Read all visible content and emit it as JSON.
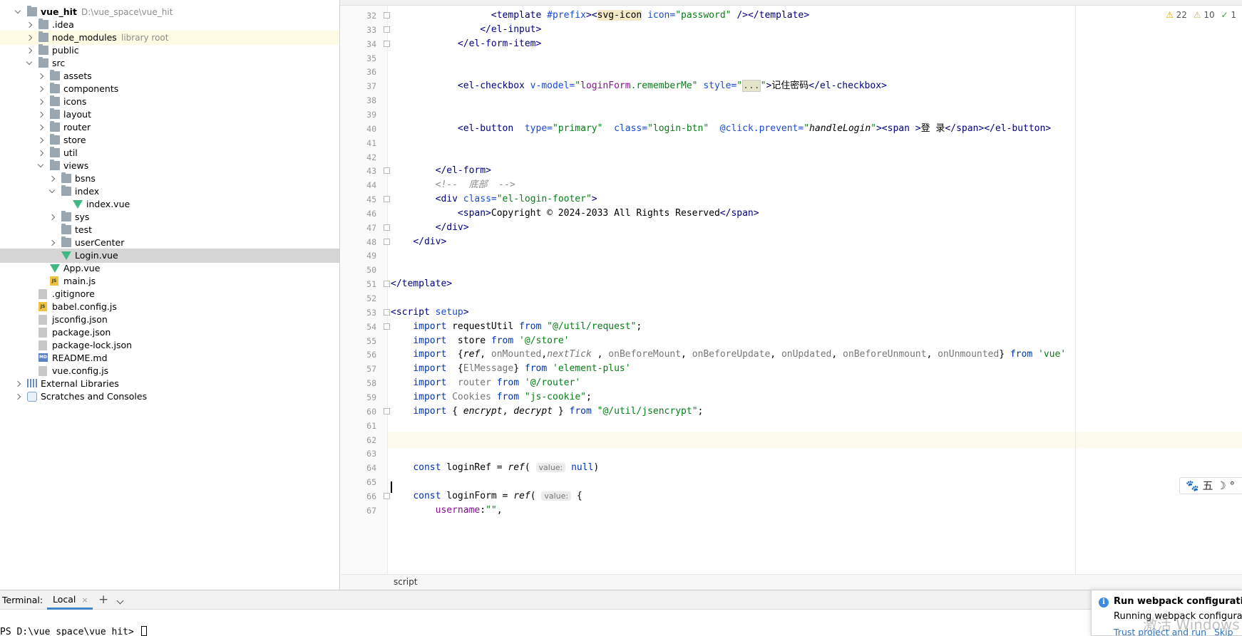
{
  "project_tree": [
    {
      "label": "vue_hit",
      "extra": "D:\\vue_space\\vue_hit",
      "depth": 0,
      "arrow": "down",
      "icon": "folder",
      "bold": true
    },
    {
      "label": ".idea",
      "depth": 1,
      "arrow": "right",
      "icon": "folder"
    },
    {
      "label": "node_modules",
      "extra": "library root",
      "depth": 1,
      "arrow": "right",
      "icon": "folder",
      "highlight": true
    },
    {
      "label": "public",
      "depth": 1,
      "arrow": "right",
      "icon": "folder"
    },
    {
      "label": "src",
      "depth": 1,
      "arrow": "down",
      "icon": "folder"
    },
    {
      "label": "assets",
      "depth": 2,
      "arrow": "right",
      "icon": "folder"
    },
    {
      "label": "components",
      "depth": 2,
      "arrow": "right",
      "icon": "folder"
    },
    {
      "label": "icons",
      "depth": 2,
      "arrow": "right",
      "icon": "folder"
    },
    {
      "label": "layout",
      "depth": 2,
      "arrow": "right",
      "icon": "folder"
    },
    {
      "label": "router",
      "depth": 2,
      "arrow": "right",
      "icon": "folder"
    },
    {
      "label": "store",
      "depth": 2,
      "arrow": "right",
      "icon": "folder"
    },
    {
      "label": "util",
      "depth": 2,
      "arrow": "right",
      "icon": "folder"
    },
    {
      "label": "views",
      "depth": 2,
      "arrow": "down",
      "icon": "folder"
    },
    {
      "label": "bsns",
      "depth": 3,
      "arrow": "right",
      "icon": "folder"
    },
    {
      "label": "index",
      "depth": 3,
      "arrow": "down",
      "icon": "folder"
    },
    {
      "label": "index.vue",
      "depth": 4,
      "arrow": "none",
      "icon": "vue"
    },
    {
      "label": "sys",
      "depth": 3,
      "arrow": "right",
      "icon": "folder"
    },
    {
      "label": "test",
      "depth": 3,
      "arrow": "none",
      "icon": "folder"
    },
    {
      "label": "userCenter",
      "depth": 3,
      "arrow": "right",
      "icon": "folder"
    },
    {
      "label": "Login.vue",
      "depth": 3,
      "arrow": "none",
      "icon": "vue",
      "selected": true
    },
    {
      "label": "App.vue",
      "depth": 2,
      "arrow": "none",
      "icon": "vue"
    },
    {
      "label": "main.js",
      "depth": 2,
      "arrow": "none",
      "icon": "js"
    },
    {
      "label": ".gitignore",
      "depth": 1,
      "arrow": "none",
      "icon": "file"
    },
    {
      "label": "babel.config.js",
      "depth": 1,
      "arrow": "none",
      "icon": "js"
    },
    {
      "label": "jsconfig.json",
      "depth": 1,
      "arrow": "none",
      "icon": "file"
    },
    {
      "label": "package.json",
      "depth": 1,
      "arrow": "none",
      "icon": "file"
    },
    {
      "label": "package-lock.json",
      "depth": 1,
      "arrow": "none",
      "icon": "file"
    },
    {
      "label": "README.md",
      "depth": 1,
      "arrow": "none",
      "icon": "md"
    },
    {
      "label": "vue.config.js",
      "depth": 1,
      "arrow": "none",
      "icon": "file"
    },
    {
      "label": "External Libraries",
      "depth": 0,
      "arrow": "right",
      "icon": "lib"
    },
    {
      "label": "Scratches and Consoles",
      "depth": 0,
      "arrow": "right",
      "icon": "scratch"
    }
  ],
  "inspections": {
    "errors_warn": "22",
    "warnings": "10",
    "ok": "1"
  },
  "code_lines": [
    {
      "n": "32",
      "fold": true,
      "tokens": [
        [
          "",
          "                  "
        ],
        [
          "tag",
          "<template "
        ],
        [
          "attr",
          "#prefix"
        ],
        [
          "tag",
          ">"
        ],
        [
          "tag",
          "<"
        ],
        [
          "hl",
          "svg-icon"
        ],
        [
          "attr",
          " icon="
        ],
        [
          "str",
          "\"password\""
        ],
        [
          "tag",
          " /></template>"
        ]
      ]
    },
    {
      "n": "33",
      "fold": true,
      "tokens": [
        [
          "",
          "                "
        ],
        [
          "tag",
          "</el-input>"
        ]
      ]
    },
    {
      "n": "34",
      "fold": true,
      "tokens": [
        [
          "",
          "            "
        ],
        [
          "tag",
          "</el-form-item>"
        ]
      ]
    },
    {
      "n": "35",
      "tokens": []
    },
    {
      "n": "36",
      "tokens": []
    },
    {
      "n": "37",
      "tokens": [
        [
          "",
          "            "
        ],
        [
          "tag",
          "<el-checkbox "
        ],
        [
          "attr",
          "v-model="
        ],
        [
          "str",
          "\""
        ],
        [
          "var",
          "loginForm"
        ],
        [
          "str",
          ".rememberMe\""
        ],
        [
          "attr",
          " style="
        ],
        [
          "str",
          "\""
        ],
        [
          "fold",
          "..."
        ],
        [
          "str",
          "\""
        ],
        [
          "tag",
          ">"
        ],
        [
          "",
          "记住密码"
        ],
        [
          "tag",
          "</el-checkbox>"
        ]
      ]
    },
    {
      "n": "38",
      "tokens": []
    },
    {
      "n": "39",
      "tokens": []
    },
    {
      "n": "40",
      "tokens": [
        [
          "",
          "            "
        ],
        [
          "tag",
          "<el-button  "
        ],
        [
          "attr",
          "type="
        ],
        [
          "str",
          "\"primary\""
        ],
        [
          "attr",
          "  class="
        ],
        [
          "str",
          "\"login-btn\""
        ],
        [
          "attr",
          "  @click.prevent="
        ],
        [
          "str",
          "\""
        ],
        [
          "fn",
          "handleLogin"
        ],
        [
          "str",
          "\""
        ],
        [
          "tag",
          "><span >"
        ],
        [
          "",
          "登 录"
        ],
        [
          "tag",
          "</span></el-button>"
        ]
      ]
    },
    {
      "n": "41",
      "tokens": []
    },
    {
      "n": "42",
      "tokens": []
    },
    {
      "n": "43",
      "fold": true,
      "tokens": [
        [
          "",
          "        "
        ],
        [
          "tag",
          "</el-form>"
        ]
      ]
    },
    {
      "n": "44",
      "tokens": [
        [
          "",
          "        "
        ],
        [
          "cm",
          "<!--  底部  -->"
        ]
      ]
    },
    {
      "n": "45",
      "fold": true,
      "tokens": [
        [
          "",
          "        "
        ],
        [
          "tag",
          "<div "
        ],
        [
          "attr",
          "class="
        ],
        [
          "str",
          "\"el-login-footer\""
        ],
        [
          "tag",
          ">"
        ]
      ]
    },
    {
      "n": "46",
      "tokens": [
        [
          "",
          "            "
        ],
        [
          "tag",
          "<span>"
        ],
        [
          "",
          "Copyright © 2024-2033 All Rights Reserved"
        ],
        [
          "tag",
          "</span>"
        ]
      ]
    },
    {
      "n": "47",
      "fold": true,
      "tokens": [
        [
          "",
          "        "
        ],
        [
          "tag",
          "</div>"
        ]
      ]
    },
    {
      "n": "48",
      "fold": true,
      "tokens": [
        [
          "",
          "    "
        ],
        [
          "tag",
          "</div>"
        ]
      ]
    },
    {
      "n": "49",
      "tokens": []
    },
    {
      "n": "50",
      "tokens": []
    },
    {
      "n": "51",
      "fold": true,
      "tokens": [
        [
          "tag",
          "</template>"
        ]
      ]
    },
    {
      "n": "52",
      "tokens": []
    },
    {
      "n": "53",
      "fold": true,
      "tokens": [
        [
          "tag",
          "<script "
        ],
        [
          "attr",
          "setup"
        ],
        [
          "tag",
          ">"
        ]
      ]
    },
    {
      "n": "54",
      "fold": true,
      "tokens": [
        [
          "",
          "    "
        ],
        [
          "kw",
          "import "
        ],
        [
          "",
          "requestUtil "
        ],
        [
          "kw",
          "from "
        ],
        [
          "str",
          "\"@/util/request\""
        ],
        [
          "",
          ";"
        ]
      ]
    },
    {
      "n": "55",
      "tokens": [
        [
          "",
          "    "
        ],
        [
          "kw",
          "import "
        ],
        [
          "",
          " store "
        ],
        [
          "kw",
          "from "
        ],
        [
          "str",
          "'@/store'"
        ]
      ]
    },
    {
      "n": "56",
      "tokens": [
        [
          "",
          "    "
        ],
        [
          "kw",
          "import "
        ],
        [
          "",
          " {"
        ],
        [
          "fn",
          "ref"
        ],
        [
          "",
          ", "
        ],
        [
          "dim",
          "onMounted"
        ],
        [
          "",
          ","
        ],
        [
          "fndim",
          "nextTick"
        ],
        [
          "",
          " , "
        ],
        [
          "dim",
          "onBeforeMount"
        ],
        [
          "",
          ", "
        ],
        [
          "dim",
          "onBeforeUpdate"
        ],
        [
          "",
          ", "
        ],
        [
          "dim",
          "onUpdated"
        ],
        [
          "",
          ", "
        ],
        [
          "dim",
          "onBeforeUnmount"
        ],
        [
          "",
          ", "
        ],
        [
          "dim",
          "onUnmounted"
        ],
        [
          "",
          "} "
        ],
        [
          "kw",
          "from "
        ],
        [
          "str",
          "'vue'"
        ]
      ]
    },
    {
      "n": "57",
      "tokens": [
        [
          "",
          "    "
        ],
        [
          "kw",
          "import "
        ],
        [
          "",
          " {"
        ],
        [
          "dim",
          "ElMessage"
        ],
        [
          "",
          "} "
        ],
        [
          "kw",
          "from "
        ],
        [
          "str",
          "'element-plus'"
        ]
      ]
    },
    {
      "n": "58",
      "tokens": [
        [
          "",
          "    "
        ],
        [
          "kw",
          "import "
        ],
        [
          "",
          " "
        ],
        [
          "dim",
          "router"
        ],
        [
          "kw",
          " from "
        ],
        [
          "str",
          "'@/router'"
        ]
      ]
    },
    {
      "n": "59",
      "tokens": [
        [
          "",
          "    "
        ],
        [
          "kw",
          "import "
        ],
        [
          "dim",
          "Cookies"
        ],
        [
          "kw",
          " from "
        ],
        [
          "str",
          "\"js-cookie\""
        ],
        [
          "",
          ";"
        ]
      ]
    },
    {
      "n": "60",
      "fold": true,
      "tokens": [
        [
          "",
          "    "
        ],
        [
          "kw",
          "import "
        ],
        [
          "",
          "{ "
        ],
        [
          "fn",
          "encrypt"
        ],
        [
          "",
          ", "
        ],
        [
          "fn",
          "decrypt"
        ],
        [
          "",
          " } "
        ],
        [
          "kw",
          "from "
        ],
        [
          "str",
          "\"@/util/jsencrypt\""
        ],
        [
          "",
          ";"
        ]
      ]
    },
    {
      "n": "61",
      "tokens": []
    },
    {
      "n": "62",
      "caret": true,
      "tokens": []
    },
    {
      "n": "63",
      "tokens": []
    },
    {
      "n": "64",
      "tokens": [
        [
          "",
          "    "
        ],
        [
          "kw",
          "const "
        ],
        [
          "",
          "loginRef = "
        ],
        [
          "fn",
          "ref"
        ],
        [
          "",
          "( "
        ],
        [
          "hint",
          "value:"
        ],
        [
          "kw",
          " null"
        ],
        [
          "",
          ")"
        ]
      ]
    },
    {
      "n": "65",
      "tokens": []
    },
    {
      "n": "66",
      "fold": true,
      "tokens": [
        [
          "",
          "    "
        ],
        [
          "kw",
          "const "
        ],
        [
          "",
          "loginForm = "
        ],
        [
          "fn",
          "ref"
        ],
        [
          "",
          "( "
        ],
        [
          "hint",
          "value:"
        ],
        [
          "",
          " {"
        ]
      ]
    },
    {
      "n": "67",
      "tokens": [
        [
          "",
          "        "
        ],
        [
          "var",
          "username"
        ],
        [
          "",
          ":"
        ],
        [
          "str",
          "\"\""
        ],
        [
          "",
          ","
        ]
      ]
    }
  ],
  "breadcrumb": "script",
  "ime_bar": {
    "paw": "🐾",
    "text": "五 ☽ °"
  },
  "terminal": {
    "title": "Terminal:",
    "tab": "Local",
    "tab_close": "×",
    "add": "+",
    "prompt": "PS D:\\vue_space\\vue_hit> "
  },
  "notification": {
    "title": "Run webpack configuration?",
    "text": "Running webpack configuration",
    "link": "Trust project and run",
    "skip": "Skip"
  },
  "watermark": "激活 Windows"
}
